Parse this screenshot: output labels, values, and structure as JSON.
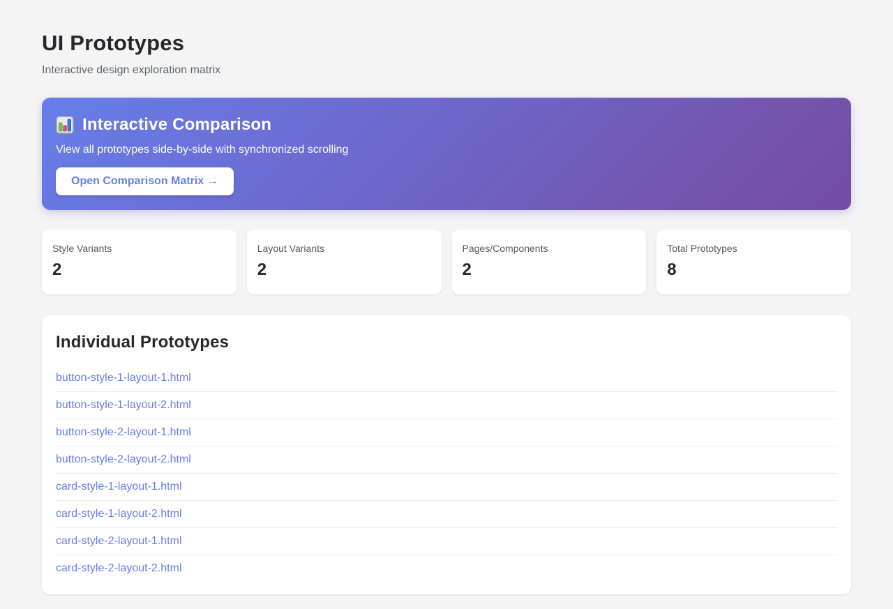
{
  "page": {
    "title": "UI Prototypes",
    "subtitle": "Interactive design exploration matrix"
  },
  "banner": {
    "icon": "bar-chart-emoji",
    "title": "Interactive Comparison",
    "description": "View all prototypes side-by-side with synchronized scrolling",
    "button_label": "Open Comparison Matrix →"
  },
  "stats": [
    {
      "label": "Style Variants",
      "value": "2"
    },
    {
      "label": "Layout Variants",
      "value": "2"
    },
    {
      "label": "Pages/Components",
      "value": "2"
    },
    {
      "label": "Total Prototypes",
      "value": "8"
    }
  ],
  "prototypes": {
    "heading": "Individual Prototypes",
    "links": [
      "button-style-1-layout-1.html",
      "button-style-1-layout-2.html",
      "button-style-2-layout-1.html",
      "button-style-2-layout-2.html",
      "card-style-1-layout-1.html",
      "card-style-1-layout-2.html",
      "card-style-2-layout-1.html",
      "card-style-2-layout-2.html"
    ]
  },
  "colors": {
    "accent": "#667eea",
    "gradient_start": "#667eea",
    "gradient_end": "#764ba2",
    "background": "#f4f4f5"
  }
}
